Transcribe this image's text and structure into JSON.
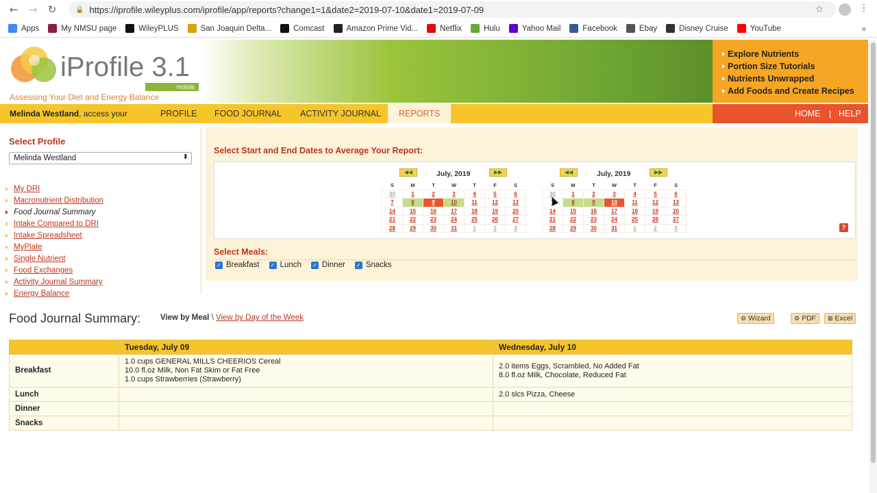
{
  "browser": {
    "url": "https://iprofile.wileyplus.com/iprofile/app/reports?change1=1&date2=2019-07-10&date1=2019-07-09",
    "bookmarks": [
      {
        "label": "Apps",
        "icon": "apps-grid-icon",
        "color": "#4285f4"
      },
      {
        "label": "My NMSU page",
        "icon": "nmsu-icon",
        "color": "#8c1d40"
      },
      {
        "label": "WileyPLUS",
        "icon": "wiley-icon",
        "color": "#111111"
      },
      {
        "label": "San Joaquin Delta...",
        "icon": "delta-icon",
        "color": "#d9a400"
      },
      {
        "label": "Comcast",
        "icon": "comcast-icon",
        "color": "#111111"
      },
      {
        "label": "Amazon Prime Vid...",
        "icon": "amazon-icon",
        "color": "#222222"
      },
      {
        "label": "Netflix",
        "icon": "netflix-icon",
        "color": "#e50914"
      },
      {
        "label": "Hulu",
        "icon": "hulu-icon",
        "color": "#66aa33"
      },
      {
        "label": "Yahoo Mail",
        "icon": "yahoo-icon",
        "color": "#5f01d1"
      },
      {
        "label": "Facebook",
        "icon": "facebook-icon",
        "color": "#3b5998"
      },
      {
        "label": "Ebay",
        "icon": "ebay-icon",
        "color": "#555555"
      },
      {
        "label": "Disney Cruise",
        "icon": "disney-icon",
        "color": "#333333"
      },
      {
        "label": "YouTube",
        "icon": "youtube-icon",
        "color": "#ff0000"
      }
    ],
    "more": "»"
  },
  "header": {
    "logo_title": "iProfile 3.1",
    "logo_badge": "mobile",
    "tagline": "Assessing Your Diet and Energy Balance",
    "quick_links": [
      "Explore Nutrients",
      "Portion Size Tutorials",
      "Nutrients Unwrapped",
      "Add Foods and Create Recipes"
    ]
  },
  "nav": {
    "user_name": "Melinda Westland",
    "user_suffix": ", access your",
    "tabs": [
      "PROFILE",
      "FOOD JOURNAL",
      "ACTIVITY JOURNAL",
      "REPORTS"
    ],
    "active_tab": "REPORTS",
    "home": "HOME",
    "separator": "|",
    "help": "HELP"
  },
  "sidebar": {
    "title": "Select Profile",
    "selected_profile": "Melinda Westland",
    "links": [
      "My DRI",
      "Macronutrient Distribution",
      "Food Journal Summary",
      "Intake Compared to DRI",
      "Intake Spreadsheet",
      "MyPlate",
      "Single Nutrient",
      "Food Exchanges",
      "Activity Journal Summary",
      "Energy Balance"
    ],
    "current_link": "Food Journal Summary"
  },
  "date_select": {
    "title": "Select Start and End Dates to Average Your Report:",
    "weekdays": [
      "S",
      "M",
      "T",
      "W",
      "T",
      "F",
      "S"
    ],
    "prev": "◀◀",
    "next": "▶▶",
    "help": "?",
    "calendars": [
      {
        "month": "July, 2019",
        "weeks": [
          [
            "30",
            "1",
            "2",
            "3",
            "4",
            "5",
            "6"
          ],
          [
            "7",
            "8",
            "9",
            "10",
            "11",
            "12",
            "13"
          ],
          [
            "14",
            "15",
            "16",
            "17",
            "18",
            "19",
            "20"
          ],
          [
            "21",
            "22",
            "23",
            "24",
            "25",
            "26",
            "27"
          ],
          [
            "28",
            "29",
            "30",
            "31",
            "1",
            "2",
            "3"
          ]
        ],
        "other_month": [
          [
            0,
            0
          ],
          [
            4,
            4
          ],
          [
            4,
            5
          ],
          [
            4,
            6
          ]
        ],
        "green": [
          [
            1,
            1
          ],
          [
            1,
            3
          ]
        ],
        "red": [
          [
            1,
            2
          ]
        ]
      },
      {
        "month": "July, 2019",
        "weeks": [
          [
            "30",
            "1",
            "2",
            "3",
            "4",
            "5",
            "6"
          ],
          [
            "7",
            "8",
            "9",
            "10",
            "11",
            "12",
            "13"
          ],
          [
            "14",
            "15",
            "16",
            "17",
            "18",
            "19",
            "20"
          ],
          [
            "21",
            "22",
            "23",
            "24",
            "25",
            "26",
            "27"
          ],
          [
            "28",
            "29",
            "30",
            "31",
            "1",
            "2",
            "3"
          ]
        ],
        "other_month": [
          [
            0,
            0
          ],
          [
            4,
            4
          ],
          [
            4,
            5
          ],
          [
            4,
            6
          ]
        ],
        "green": [
          [
            1,
            1
          ],
          [
            1,
            2
          ]
        ],
        "red": [
          [
            1,
            3
          ]
        ]
      }
    ]
  },
  "meals": {
    "title": "Select Meals:",
    "options": [
      {
        "label": "Breakfast",
        "checked": true
      },
      {
        "label": "Lunch",
        "checked": true
      },
      {
        "label": "Dinner",
        "checked": true
      },
      {
        "label": "Snacks",
        "checked": true
      }
    ]
  },
  "summary": {
    "title": "Food Journal Summary:",
    "view_by_meal": "View by Meal",
    "view_separator": " \\ ",
    "view_by_day": "View by Day of the Week",
    "export": {
      "wizard": "Wizard",
      "pdf": "PDF",
      "excel": "Excel"
    },
    "columns": [
      "Tuesday, July 09",
      "Wednesday, July 10"
    ],
    "rows": [
      {
        "meal": "Breakfast",
        "day1": [
          "1.0 cups GENERAL MILLS CHEERIOS Cereal",
          "10.0 fl.oz Milk, Non Fat Skim or Fat Free",
          "1.0 cups Strawberries (Strawberry)"
        ],
        "day2": [
          "2.0 items Eggs, Scrambled, No Added Fat",
          "8.0 fl.oz Milk, Chocolate, Reduced Fat"
        ]
      },
      {
        "meal": "Lunch",
        "day1": [],
        "day2": [
          "2.0 slcs Pizza, Cheese"
        ]
      },
      {
        "meal": "Dinner",
        "day1": [],
        "day2": []
      },
      {
        "meal": "Snacks",
        "day1": [],
        "day2": []
      }
    ]
  }
}
